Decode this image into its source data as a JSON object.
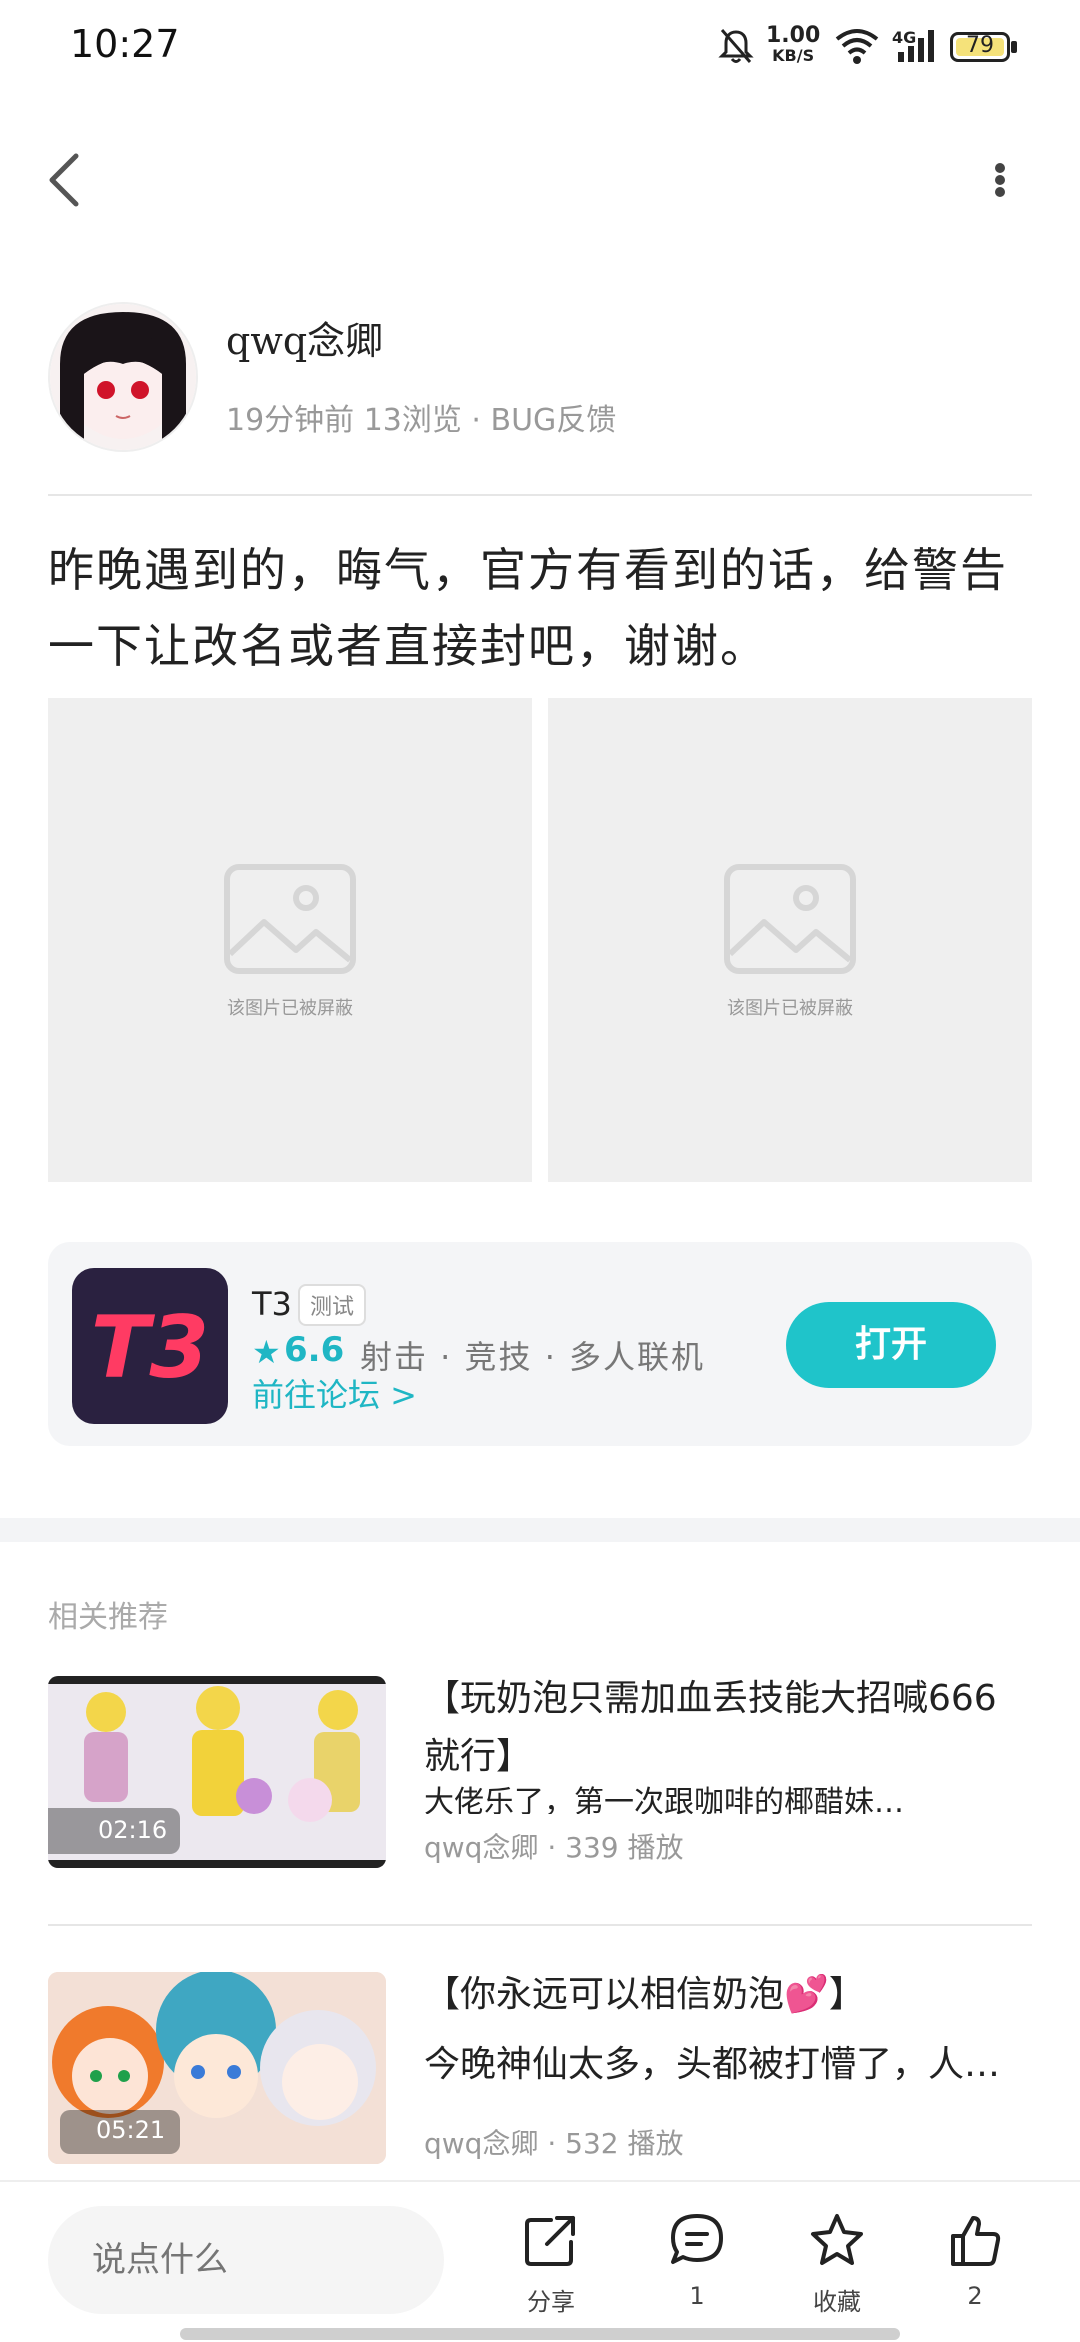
{
  "status_bar": {
    "time": "10:27",
    "net_speed_value": "1.00",
    "net_speed_unit": "KB/S",
    "network": "4G",
    "battery": "79"
  },
  "icons": {
    "back": "back-arrow-icon",
    "more": "more-vertical-icon",
    "blocked": "image-placeholder-icon",
    "share": "share-icon",
    "comment": "comment-icon",
    "favorite": "star-icon",
    "like": "thumbs-up-icon"
  },
  "author": {
    "name": "qwq念卿",
    "meta": "19分钟前 13浏览 · BUG反馈"
  },
  "post": {
    "text": "昨晚遇到的，晦气，官方有看到的话，给警告一下让改名或者直接封吧，谢谢。",
    "images": [
      {
        "caption": "该图片已被屏蔽"
      },
      {
        "caption": "该图片已被屏蔽"
      }
    ]
  },
  "app_card": {
    "name": "T3",
    "tag": "测试",
    "rating": "6.6",
    "genres": "射击 · 竞技 · 多人联机",
    "forum_link": "前往论坛 >",
    "open_label": "打开",
    "icon_text": "T3"
  },
  "related": {
    "title": "相关推荐",
    "items": [
      {
        "duration": "02:16",
        "title": "【玩奶泡只需加血丢技能大招喊666就行】",
        "subtitle": "大佬乐了，第一次跟咖啡的椰醋妹…",
        "meta": "qwq念卿 · 339 播放"
      },
      {
        "duration": "05:21",
        "title": "【你永远可以相信奶泡💕】",
        "subtitle": "今晚神仙太多，头都被打懵了，人…",
        "meta": "qwq念卿 · 532 播放"
      }
    ]
  },
  "bottom_bar": {
    "comment_placeholder": "说点什么",
    "share_label": "分享",
    "comment_count": "1",
    "favorite_label": "收藏",
    "like_count": "2"
  },
  "colors": {
    "accent": "#1fc4ca",
    "placeholder_bg": "#efefef"
  }
}
